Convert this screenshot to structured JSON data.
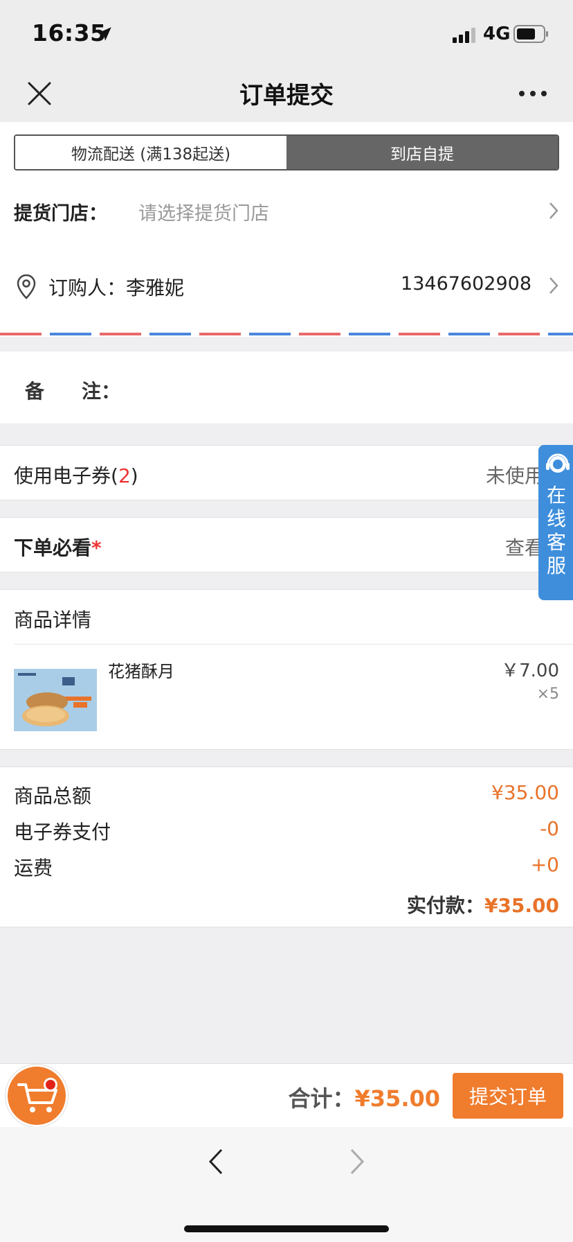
{
  "status_bar": {
    "time": "16:35",
    "network": "4G"
  },
  "nav": {
    "title": "订单提交"
  },
  "delivery": {
    "option_logistics": "物流配送 (满138起送)",
    "option_pickup": "到店自提",
    "selected": "到店自提"
  },
  "store": {
    "label": "提货门店：",
    "placeholder": "请选择提货门店"
  },
  "buyer": {
    "label": "订购人：李雅妮",
    "phone": "13467602908"
  },
  "remark": {
    "label_left": "备",
    "label_right": "注："
  },
  "coupon": {
    "label_prefix": "使用电子券(",
    "count": "2",
    "label_suffix": ")",
    "status": "未使用"
  },
  "notice": {
    "label": "下单必看",
    "required_mark": "*",
    "action": "查看"
  },
  "goods": {
    "title": "商品详情",
    "items": [
      {
        "name": "花猪酥月",
        "price": "￥7.00",
        "quantity": "×5"
      }
    ]
  },
  "summary": {
    "subtotal_label": "商品总额",
    "subtotal_value": "¥35.00",
    "coupon_label": "电子券支付",
    "coupon_value": "-0",
    "shipping_label": "运费",
    "shipping_value": "+0",
    "paid_label": "实付款：",
    "paid_value": "¥35.00"
  },
  "customer_service": {
    "label": "在线客服"
  },
  "bottom": {
    "total_label": "合计：",
    "total_value": "¥35.00",
    "submit_label": "提交订单"
  },
  "colors": {
    "accent": "#f07c2d",
    "cs_blue": "#3e8edc",
    "toggle_active": "#666666",
    "red": "#e33333"
  }
}
